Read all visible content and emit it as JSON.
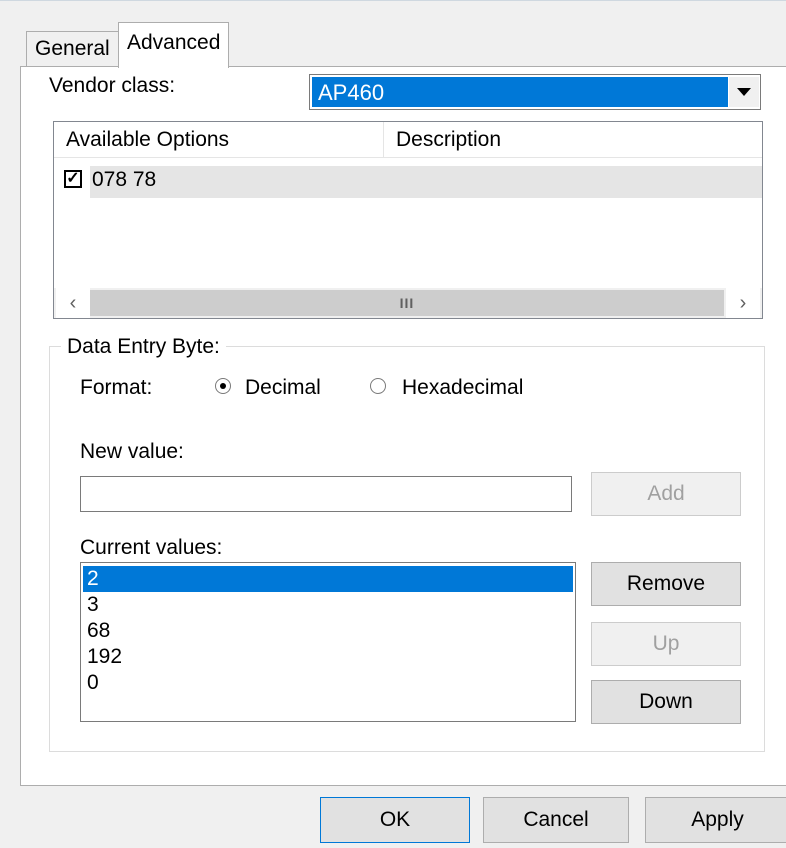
{
  "tabs": [
    {
      "label": "General",
      "active": false
    },
    {
      "label": "Advanced",
      "active": true
    }
  ],
  "vendor_class": {
    "label": "Vendor class:",
    "selected": "AP460"
  },
  "available_options": {
    "columns": [
      "Available Options",
      "Description"
    ],
    "rows": [
      {
        "checked": true,
        "option": "078 78",
        "description": ""
      }
    ],
    "scrollbar_thumb": "III"
  },
  "data_entry": {
    "group_title": "Data Entry Byte:",
    "format_label": "Format:",
    "format_options": [
      {
        "label": "Decimal",
        "selected": true
      },
      {
        "label": "Hexadecimal",
        "selected": false
      }
    ],
    "new_value_label": "New value:",
    "new_value": "",
    "add_label": "Add",
    "current_values_label": "Current values:",
    "current_values": [
      "2",
      "3",
      "68",
      "192",
      "0"
    ],
    "selected_index": 0,
    "remove_label": "Remove",
    "up_label": "Up",
    "down_label": "Down"
  },
  "dialog_buttons": {
    "ok": "OK",
    "cancel": "Cancel",
    "apply": "Apply"
  },
  "colors": {
    "selection": "#0078d7",
    "disabled_text": "#a0a0a0"
  }
}
